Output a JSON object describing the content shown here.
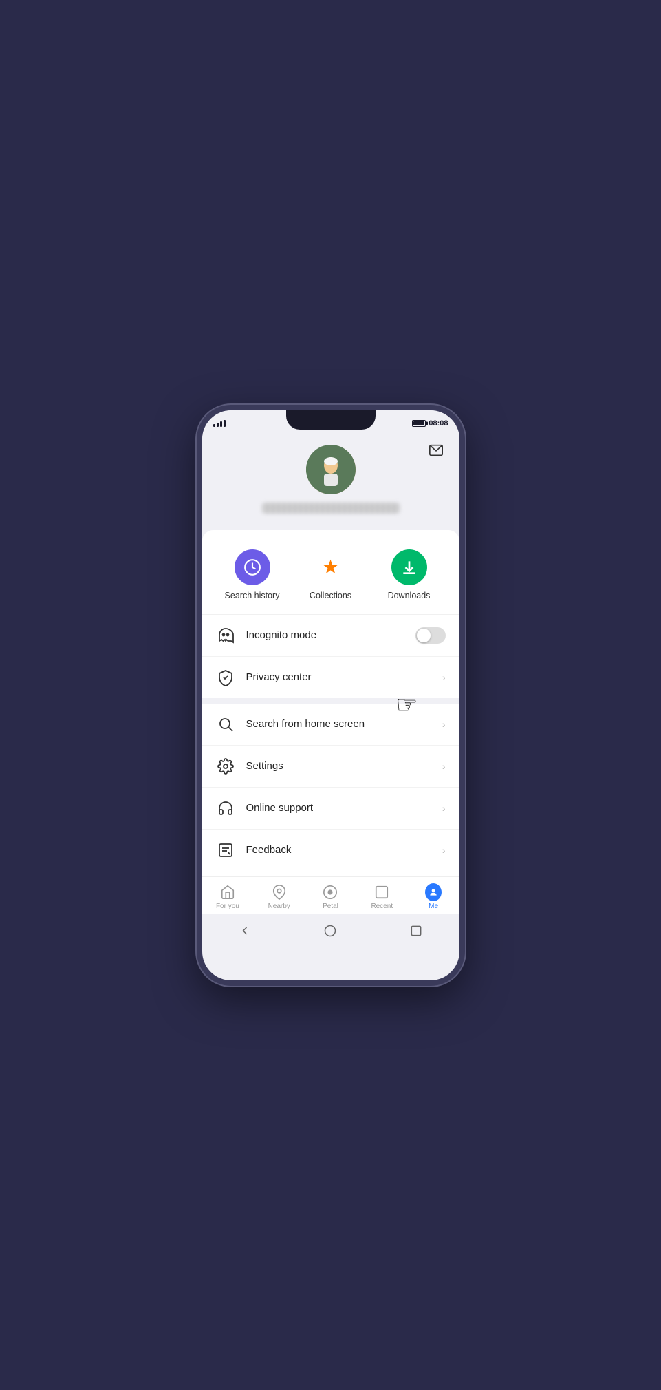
{
  "status": {
    "time": "08:08",
    "battery_level": "85%"
  },
  "profile": {
    "avatar_emoji": "🏌️",
    "username_placeholder": "blurred username"
  },
  "shortcuts": [
    {
      "id": "search-history",
      "label": "Search history",
      "color": "purple",
      "icon": "clock"
    },
    {
      "id": "collections",
      "label": "Collections",
      "color": "orange",
      "icon": "star"
    },
    {
      "id": "downloads",
      "label": "Downloads",
      "color": "green",
      "icon": "download"
    }
  ],
  "menu_group1": [
    {
      "id": "incognito-mode",
      "label": "Incognito mode",
      "type": "toggle",
      "icon": "ghost"
    },
    {
      "id": "privacy-center",
      "label": "Privacy center",
      "type": "chevron",
      "icon": "shield"
    }
  ],
  "menu_group2": [
    {
      "id": "search-home",
      "label": "Search from home screen",
      "type": "chevron",
      "icon": "search"
    },
    {
      "id": "settings",
      "label": "Settings",
      "type": "chevron",
      "icon": "gear"
    },
    {
      "id": "online-support",
      "label": "Online support",
      "type": "chevron",
      "icon": "headset"
    },
    {
      "id": "feedback",
      "label": "Feedback",
      "type": "chevron",
      "icon": "feedback"
    }
  ],
  "bottom_nav": [
    {
      "id": "for-you",
      "label": "For you",
      "active": false,
      "icon": "home"
    },
    {
      "id": "nearby",
      "label": "Nearby",
      "active": false,
      "icon": "location"
    },
    {
      "id": "petal",
      "label": "Petal",
      "active": false,
      "icon": "face"
    },
    {
      "id": "recent",
      "label": "Recent",
      "active": false,
      "icon": "square"
    },
    {
      "id": "me",
      "label": "Me",
      "active": true,
      "icon": "person"
    }
  ],
  "mail_button_label": "Mail",
  "cursor_visible": true
}
